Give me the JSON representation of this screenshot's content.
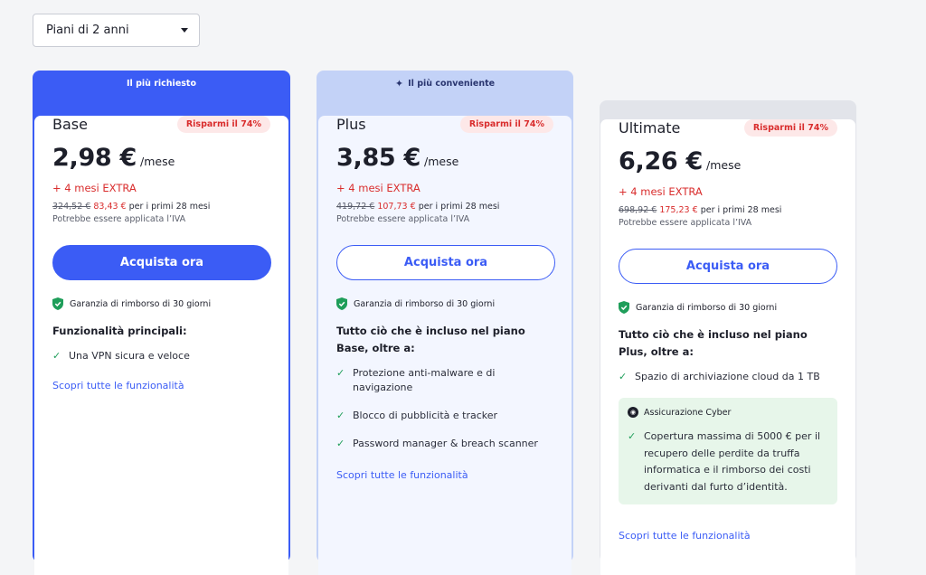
{
  "period_select": {
    "value": "Piani di 2 anni"
  },
  "plans": {
    "base": {
      "banner": "Il più richiesto",
      "name": "Base",
      "badge": "Risparmi il 74%",
      "price": "2,98 €",
      "per": "/mese",
      "extra": "+ 4 mesi EXTRA",
      "old_price": "324,52 €",
      "new_price": "83,43 €",
      "period_note": "per i primi 28 mesi",
      "vat": "Potrebbe essere applicata l’IVA",
      "cta": "Acquista ora",
      "guarantee": "Garanzia di rimborso di 30 giorni",
      "features_title": "Funzionalità principali:",
      "features": [
        "Una VPN sicura e veloce"
      ],
      "discover": "Scopri tutte le funzionalità"
    },
    "plus": {
      "banner": "Il più conveniente",
      "name": "Plus",
      "badge": "Risparmi il 74%",
      "price": "3,85 €",
      "per": "/mese",
      "extra": "+ 4 mesi EXTRA",
      "old_price": "419,72 €",
      "new_price": "107,73 €",
      "period_note": "per i primi 28 mesi",
      "vat": "Potrebbe essere applicata l’IVA",
      "cta": "Acquista ora",
      "guarantee": "Garanzia di rimborso di 30 giorni",
      "features_title": "Tutto ciò che è incluso nel piano Base, oltre a:",
      "features": [
        "Protezione anti-malware e di navigazione",
        "Blocco di pubblicità e tracker",
        "Password manager & breach scanner"
      ],
      "discover": "Scopri tutte le funzionalità"
    },
    "ultimate": {
      "name": "Ultimate",
      "badge": "Risparmi il 74%",
      "price": "6,26 €",
      "per": "/mese",
      "extra": "+ 4 mesi EXTRA",
      "old_price": "698,92 €",
      "new_price": "175,23 €",
      "period_note": "per i primi 28 mesi",
      "vat": "Potrebbe essere applicata l’IVA",
      "cta": "Acquista ora",
      "guarantee": "Garanzia di rimborso di 30 giorni",
      "features_title": "Tutto ciò che è incluso nel piano Plus, oltre a:",
      "features": [
        "Spazio di archiviazione cloud da 1 TB"
      ],
      "cyber_title": "Assicurazione Cyber",
      "cyber_feature": "Copertura massima di 5000 € per il recupero delle perdite da truffa informatica e il rimborso dei costi derivanti dal furto d’identità.",
      "discover": "Scopri tutte le funzionalità"
    }
  },
  "colors": {
    "accent": "#3b5cf5",
    "savings_red": "#d92d2d",
    "check_green": "#1f9e5a",
    "plus_tint": "#f3f6ff",
    "cyber_bg": "#e7f6ea"
  },
  "icons": {
    "dropdown": "chevron-down-icon",
    "guarantee": "shield-check-icon",
    "feature": "check-icon",
    "banner_plus": "sparkle-icon",
    "cyber": "cyber-insurance-icon"
  }
}
